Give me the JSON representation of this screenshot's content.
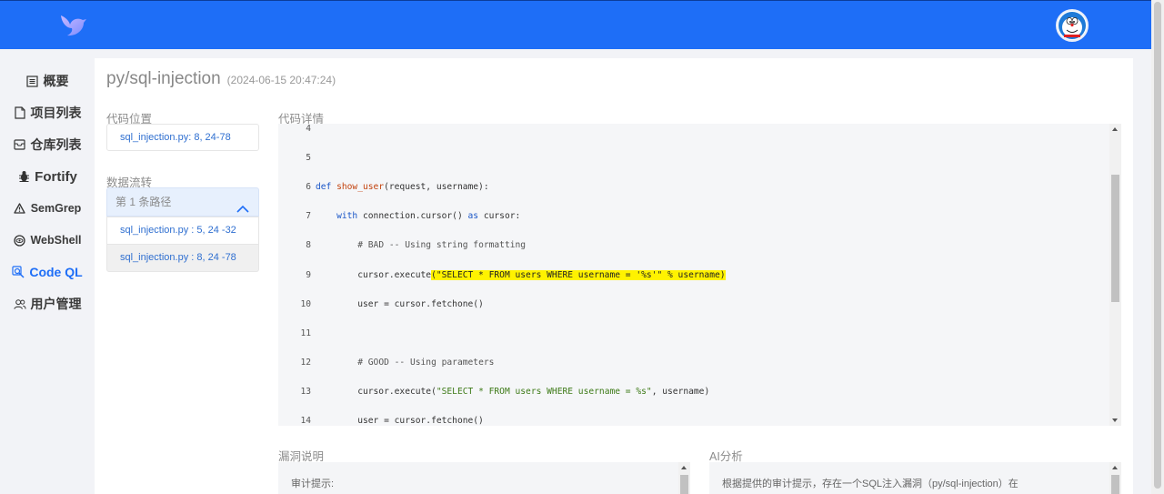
{
  "header": {
    "logo_icon": "bird-logo-icon",
    "avatar_icon": "doraemon-avatar-icon",
    "bg_color": "#1e6ef7"
  },
  "sidebar": {
    "items": [
      {
        "label": "概要",
        "icon": "list-icon"
      },
      {
        "label": "项目列表",
        "icon": "file-icon"
      },
      {
        "label": "仓库列表",
        "icon": "inbox-icon"
      },
      {
        "label": "Fortify",
        "icon": "bug-icon"
      },
      {
        "label": "SemGrep",
        "icon": "warning-icon"
      },
      {
        "label": "WebShell",
        "icon": "eye-icon"
      },
      {
        "label": "Code QL",
        "icon": "search-code-icon",
        "active": true
      },
      {
        "label": "用户管理",
        "icon": "users-icon"
      }
    ]
  },
  "main": {
    "title": "py/sql-injection",
    "timestamp": "(2024-06-15 20:47:24)",
    "code_location_label": "代码位置",
    "code_location_value": "sql_injection.py: 8, 24-78",
    "data_flow_label": "数据流转",
    "path_header": "第 1 条路径",
    "paths": [
      "sql_injection.py : 5, 24 -32",
      "sql_injection.py : 8, 24 -78"
    ],
    "code_detail_label": "代码详情",
    "vuln_desc_label": "漏洞说明",
    "vuln_desc_text": "审计提示:",
    "ai_label": "AI分析",
    "ai_text": "根据提供的审计提示，存在一个SQL注入漏洞（py/sql-injection）在"
  },
  "code": {
    "lines": [
      {
        "n": "4",
        "segs": []
      },
      {
        "n": "5",
        "segs": []
      },
      {
        "n": "6",
        "segs": [
          {
            "t": "def ",
            "c": "kw"
          },
          {
            "t": "show_user",
            "c": "fn"
          },
          {
            "t": "(request, username):",
            "c": ""
          }
        ]
      },
      {
        "n": "7",
        "segs": [
          {
            "t": "    ",
            "c": ""
          },
          {
            "t": "with",
            "c": "kw"
          },
          {
            "t": " connection.cursor() ",
            "c": ""
          },
          {
            "t": "as",
            "c": "kw"
          },
          {
            "t": " cursor:",
            "c": ""
          }
        ]
      },
      {
        "n": "8",
        "segs": [
          {
            "t": "        ",
            "c": ""
          },
          {
            "t": "# BAD -- Using string formatting",
            "c": "cm"
          }
        ]
      },
      {
        "n": "9",
        "segs": [
          {
            "t": "        cursor.execute",
            "c": ""
          },
          {
            "t": "(\"SELECT * FROM users WHERE username = '%s'\" % username)",
            "c": "hl"
          }
        ]
      },
      {
        "n": "10",
        "segs": [
          {
            "t": "        user = cursor.fetchone()",
            "c": ""
          }
        ]
      },
      {
        "n": "11",
        "segs": []
      },
      {
        "n": "12",
        "segs": [
          {
            "t": "        ",
            "c": ""
          },
          {
            "t": "# GOOD -- Using parameters",
            "c": "cm"
          }
        ]
      },
      {
        "n": "13",
        "segs": [
          {
            "t": "        cursor.execute(",
            "c": ""
          },
          {
            "t": "\"SELECT * FROM users WHERE username = %s\"",
            "c": "st"
          },
          {
            "t": ", username)",
            "c": ""
          }
        ]
      },
      {
        "n": "14",
        "segs": [
          {
            "t": "        user = cursor.fetchone()",
            "c": ""
          }
        ]
      }
    ]
  }
}
